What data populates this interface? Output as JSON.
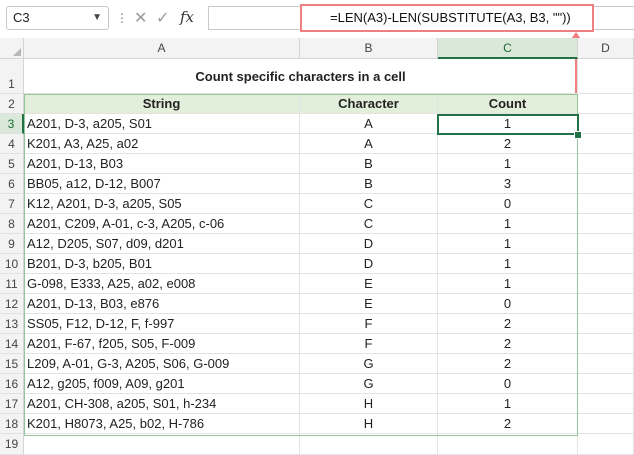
{
  "namebox": {
    "value": "C3"
  },
  "formula_bar": {
    "formula": "=LEN(A3)-LEN(SUBSTITUTE(A3, B3, \"\"))",
    "fx_label": "fx",
    "cancel_glyph": "✕",
    "enter_glyph": "✓"
  },
  "columns": [
    "A",
    "B",
    "C",
    "D"
  ],
  "rows": [
    "1",
    "2",
    "3",
    "4",
    "5",
    "6",
    "7",
    "8",
    "9",
    "10",
    "11",
    "12",
    "13",
    "14",
    "15",
    "16",
    "17",
    "18",
    "19"
  ],
  "sheet": {
    "title": "Count specific characters in a cell",
    "headers": {
      "string": "String",
      "character": "Character",
      "count": "Count"
    },
    "data": [
      {
        "string": "A201, D-3, a205, S01",
        "character": "A",
        "count": "1"
      },
      {
        "string": "K201, A3, A25, a02",
        "character": "A",
        "count": "2"
      },
      {
        "string": "A201, D-13, B03",
        "character": "B",
        "count": "1"
      },
      {
        "string": "BB05, a12, D-12, B007",
        "character": "B",
        "count": "3"
      },
      {
        "string": "K12, A201, D-3, a205, S05",
        "character": "C",
        "count": "0"
      },
      {
        "string": "A201, C209, A-01, c-3, A205, c-06",
        "character": "C",
        "count": "1"
      },
      {
        "string": "A12, D205, S07, d09, d201",
        "character": "D",
        "count": "1"
      },
      {
        "string": "B201, D-3, b205, B01",
        "character": "D",
        "count": "1"
      },
      {
        "string": "G-098, E333, A25, a02, e008",
        "character": "E",
        "count": "1"
      },
      {
        "string": "A201, D-13, B03, e876",
        "character": "E",
        "count": "0"
      },
      {
        "string": "SS05, F12, D-12, F, f-997",
        "character": "F",
        "count": "2"
      },
      {
        "string": "A201, F-67, f205, S05, F-009",
        "character": "F",
        "count": "2"
      },
      {
        "string": "L209, A-01, G-3, A205, S06, G-009",
        "character": "G",
        "count": "2"
      },
      {
        "string": "A12, g205, f009, A09, g201",
        "character": "G",
        "count": "0"
      },
      {
        "string": "A201, CH-308, a205, S01, h-234",
        "character": "H",
        "count": "1"
      },
      {
        "string": "K201, H8073, A25, b02, H-786",
        "character": "H",
        "count": "2"
      }
    ]
  },
  "colors": {
    "selection": "#217346",
    "header_fill": "#e2efda",
    "callout": "#f08080"
  }
}
